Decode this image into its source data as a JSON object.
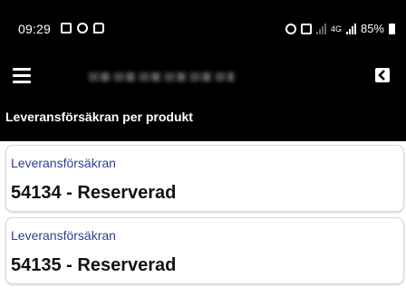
{
  "status_bar": {
    "time": "09:29",
    "battery": "85%",
    "network_label": "4G"
  },
  "toolbar": {
    "menu_icon": "hamburger-menu-icon",
    "back_icon": "back-arrow-icon"
  },
  "page": {
    "title": "Leveransförsäkran per produkt"
  },
  "items": [
    {
      "label": "Leveransförsäkran",
      "value": "54134 - Reserverad"
    },
    {
      "label": "Leveransförsäkran",
      "value": "54135 - Reserverad"
    }
  ],
  "colors": {
    "background": "#ffffff",
    "bar": "#000000",
    "label": "#2f3e8f",
    "value": "#111111"
  }
}
